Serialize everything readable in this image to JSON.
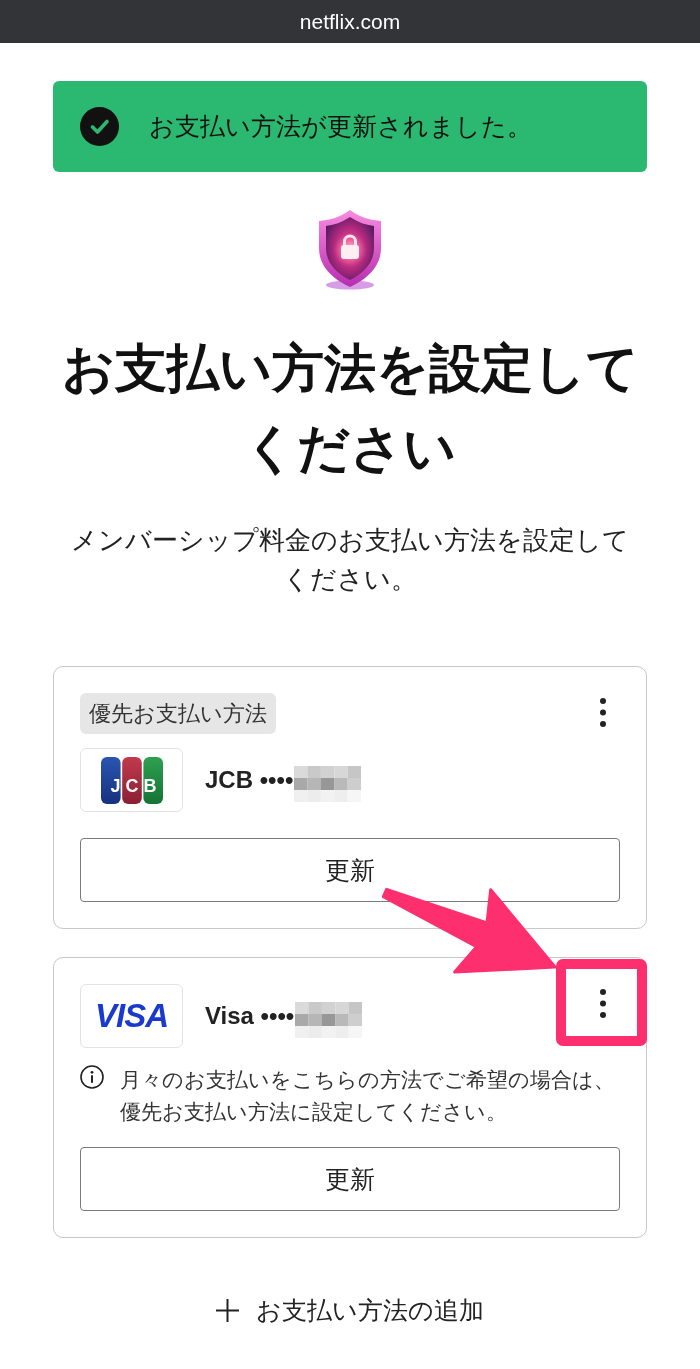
{
  "address_bar": {
    "url": "netflix.com"
  },
  "banner": {
    "kind": "success",
    "message": "お支払い方法が更新されました。"
  },
  "title": "お支払い方法を設定してください",
  "subtitle": "メンバーシップ料金のお支払い方法を設定してください。",
  "payment_methods": [
    {
      "kind": "jcb",
      "logo_text": "JCB",
      "badge": "優先お支払い方法",
      "label": "JCB ••••",
      "number_redacted": true,
      "button": "更新",
      "menu_highlighted": false
    },
    {
      "kind": "visa",
      "logo_text": "VISA",
      "label": "Visa ••••",
      "number_redacted": true,
      "note": "月々のお支払いをこちらの方法でご希望の場合は、優先お支払い方法に設定してください。",
      "button": "更新",
      "menu_highlighted": true
    }
  ],
  "add_button": "お支払い方法の追加"
}
